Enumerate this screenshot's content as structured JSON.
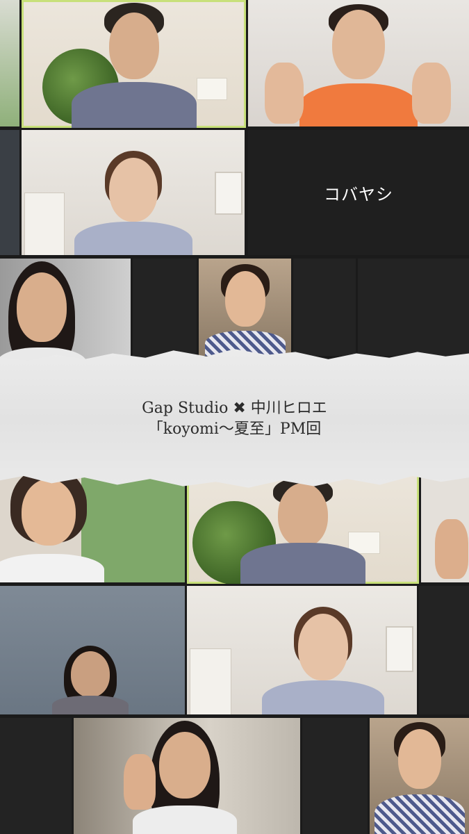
{
  "participant_name": "コバヤシ",
  "banner": {
    "line1": "Gap Studio ✖ 中川ヒロエ",
    "line2": "「koyomi〜夏至」PM回"
  },
  "colors": {
    "active_speaker_border": "#c8e07a",
    "background": "#1b1b1b",
    "banner_paper": "#e6e6e6"
  }
}
